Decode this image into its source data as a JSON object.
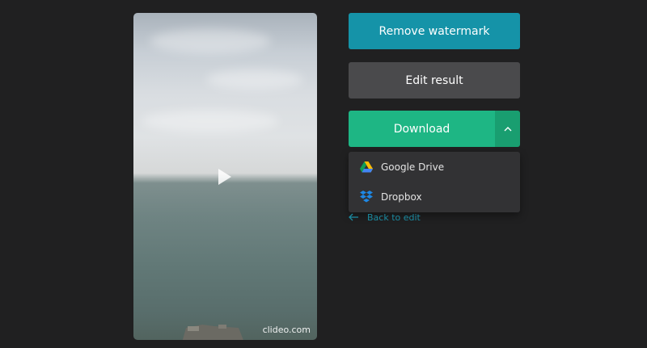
{
  "video": {
    "watermark": "clideo.com",
    "play_icon": "play-icon"
  },
  "actions": {
    "remove_watermark_label": "Remove watermark",
    "edit_result_label": "Edit result",
    "download_label": "Download",
    "toggle_icon": "chevron-up-icon"
  },
  "download_menu": {
    "items": [
      {
        "label": "Google Drive",
        "icon": "google-drive-icon"
      },
      {
        "label": "Dropbox",
        "icon": "dropbox-icon"
      }
    ]
  },
  "back_link": {
    "label": "Back to edit",
    "icon": "arrow-left-icon"
  },
  "colors": {
    "background": "#202021",
    "watermark_button": "#1593a8",
    "edit_button": "#4a4a4c",
    "download_button": "#1eb684",
    "download_toggle": "#199e70",
    "dropdown_bg": "#323234",
    "link": "#1b8aa0"
  }
}
